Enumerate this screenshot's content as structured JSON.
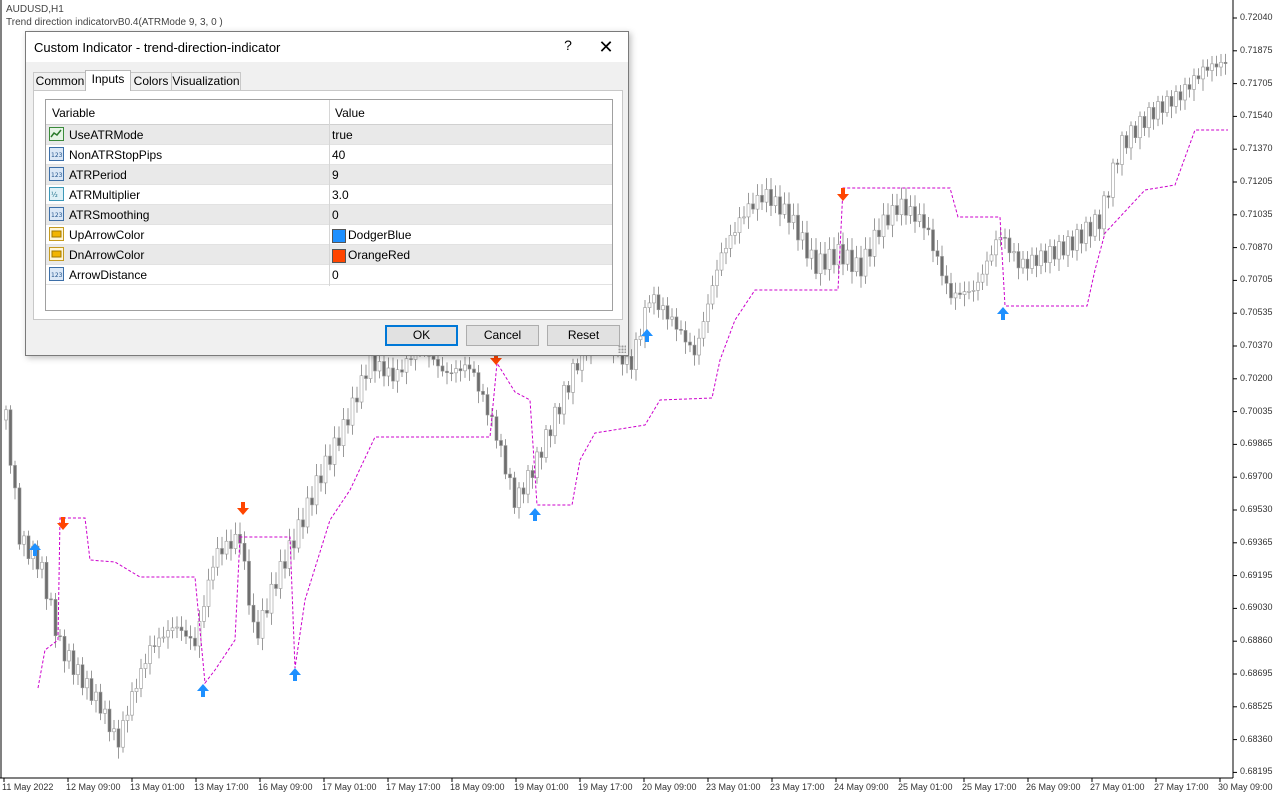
{
  "chart": {
    "symbol_title": "AUDUSD,H1",
    "indicator_title": "Trend direction indicatorvB0.4(ATRMode 9, 3, 0 )",
    "colors": {
      "bull": "#ffffff",
      "bear": "#6e6e6e",
      "wick": "#9a9a9a",
      "stop_line": "#cc00cc",
      "up_arrow": "#1e90ff",
      "down_arrow": "#ff4500"
    },
    "price_labels": [
      "0.72040",
      "0.71875",
      "0.71705",
      "0.71540",
      "0.71370",
      "0.71205",
      "0.71035",
      "0.70870",
      "0.70705",
      "0.70535",
      "0.70370",
      "0.70200",
      "0.70035",
      "0.69865",
      "0.69700",
      "0.69530",
      "0.69365",
      "0.69195",
      "0.69030",
      "0.68860",
      "0.68695",
      "0.68525",
      "0.68360",
      "0.68195"
    ],
    "time_labels": [
      "11 May 2022",
      "12 May 09:00",
      "13 May 01:00",
      "13 May 17:00",
      "16 May 09:00",
      "17 May 01:00",
      "17 May 17:00",
      "18 May 09:00",
      "19 May 01:00",
      "19 May 17:00",
      "20 May 09:00",
      "23 May 01:00",
      "23 May 17:00",
      "24 May 09:00",
      "25 May 01:00",
      "25 May 17:00",
      "26 May 09:00",
      "27 May 01:00",
      "27 May 17:00",
      "30 May 09:00"
    ]
  },
  "dialog": {
    "title": "Custom Indicator - trend-direction-indicator",
    "help_label": "?",
    "close_label": "✕",
    "tabs": [
      {
        "label": "Common"
      },
      {
        "label": "Inputs"
      },
      {
        "label": "Colors"
      },
      {
        "label": "Visualization"
      }
    ],
    "active_tab": "Inputs",
    "columns": {
      "variable": "Variable",
      "value": "Value"
    },
    "params": [
      {
        "name": "UseATRMode",
        "value": "true",
        "icon": "bool-icon"
      },
      {
        "name": "NonATRStopPips",
        "value": "40",
        "icon": "int-icon"
      },
      {
        "name": "ATRPeriod",
        "value": "9",
        "icon": "int-icon"
      },
      {
        "name": "ATRMultiplier",
        "value": "3.0",
        "icon": "double-icon"
      },
      {
        "name": "ATRSmoothing",
        "value": "0",
        "icon": "int-icon"
      },
      {
        "name": "UpArrowColor",
        "value": "DodgerBlue",
        "icon": "color-icon",
        "swatch": "#1e90ff"
      },
      {
        "name": "DnArrowColor",
        "value": "OrangeRed",
        "icon": "color-icon",
        "swatch": "#ff4500"
      },
      {
        "name": "ArrowDistance",
        "value": "0",
        "icon": "int-icon"
      }
    ],
    "buttons": {
      "ok": "OK",
      "cancel": "Cancel",
      "reset": "Reset"
    }
  }
}
